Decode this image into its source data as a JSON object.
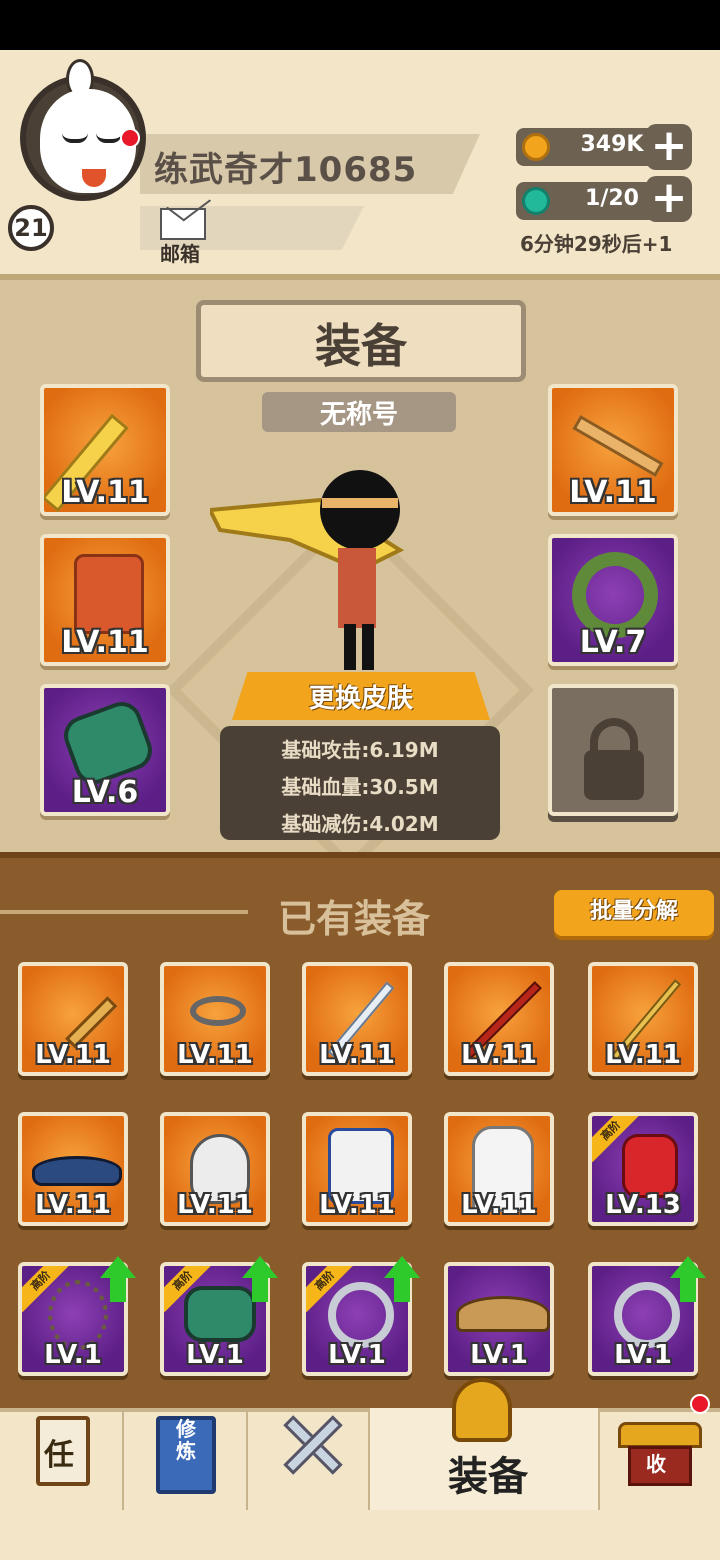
{
  "player": {
    "name": "练武奇才10685",
    "level": "21",
    "mail_label": "邮箱"
  },
  "resources": {
    "coins": "349K",
    "stamina": "1/20",
    "timer": "6分钟29秒后+1"
  },
  "equip_panel": {
    "title": "装备",
    "player_title": "无称号",
    "skin_button": "更换皮肤",
    "stats": [
      "基础攻击:6.19M",
      "基础血量:30.5M",
      "基础减伤:4.02M"
    ],
    "slots": {
      "weapon": {
        "level": "LV.11",
        "rarity": "orange",
        "icon": "golden-broadsword-icon"
      },
      "armor": {
        "level": "LV.11",
        "rarity": "orange",
        "icon": "armor-icon"
      },
      "bracer": {
        "level": "LV.6",
        "rarity": "purple",
        "icon": "jade-bracer-icon"
      },
      "hair": {
        "level": "LV.11",
        "rarity": "orange",
        "icon": "hairpin-icon"
      },
      "ring": {
        "level": "LV.7",
        "rarity": "purple",
        "icon": "jade-ring-icon"
      },
      "locked": {
        "icon": "padlock-icon"
      }
    }
  },
  "owned": {
    "title": "已有装备",
    "batch_button": "批量分解",
    "high_tag": "高阶",
    "items": [
      {
        "level": "LV.11",
        "rarity": "orange",
        "icon": "mace-icon"
      },
      {
        "level": "LV.11",
        "rarity": "orange",
        "icon": "scissors-icon"
      },
      {
        "level": "LV.11",
        "rarity": "orange",
        "icon": "sword-icon"
      },
      {
        "level": "LV.11",
        "rarity": "orange",
        "icon": "staff-icon"
      },
      {
        "level": "LV.11",
        "rarity": "orange",
        "icon": "spear-icon"
      },
      {
        "level": "LV.11",
        "rarity": "orange",
        "icon": "hat-icon"
      },
      {
        "level": "LV.11",
        "rarity": "orange",
        "icon": "helmet-icon"
      },
      {
        "level": "LV.11",
        "rarity": "orange",
        "icon": "robe-icon"
      },
      {
        "level": "LV.11",
        "rarity": "orange",
        "icon": "hoodie-icon"
      },
      {
        "level": "LV.13",
        "rarity": "purple",
        "icon": "gauntlet-icon",
        "high": true
      },
      {
        "level": "LV.1",
        "rarity": "purple",
        "icon": "necklace-icon",
        "high": true,
        "upgrade": true
      },
      {
        "level": "LV.1",
        "rarity": "purple",
        "icon": "bracer-icon",
        "high": true,
        "upgrade": true
      },
      {
        "level": "LV.1",
        "rarity": "purple",
        "icon": "ring-icon",
        "high": true,
        "upgrade": true
      },
      {
        "level": "LV.1",
        "rarity": "purple",
        "icon": "straw-hat-icon"
      },
      {
        "level": "LV.1",
        "rarity": "purple",
        "icon": "ring-icon",
        "upgrade": true
      }
    ]
  },
  "nav": {
    "task_glyph": "任",
    "cultivate_glyph": "修炼",
    "shop_glyph": "收",
    "active_label": "装备"
  },
  "colors": {
    "orange_rarity": "#e06c12",
    "purple_rarity": "#5c1f86",
    "accent": "#f2a51c",
    "upgrade_arrow": "#2ec92b"
  }
}
